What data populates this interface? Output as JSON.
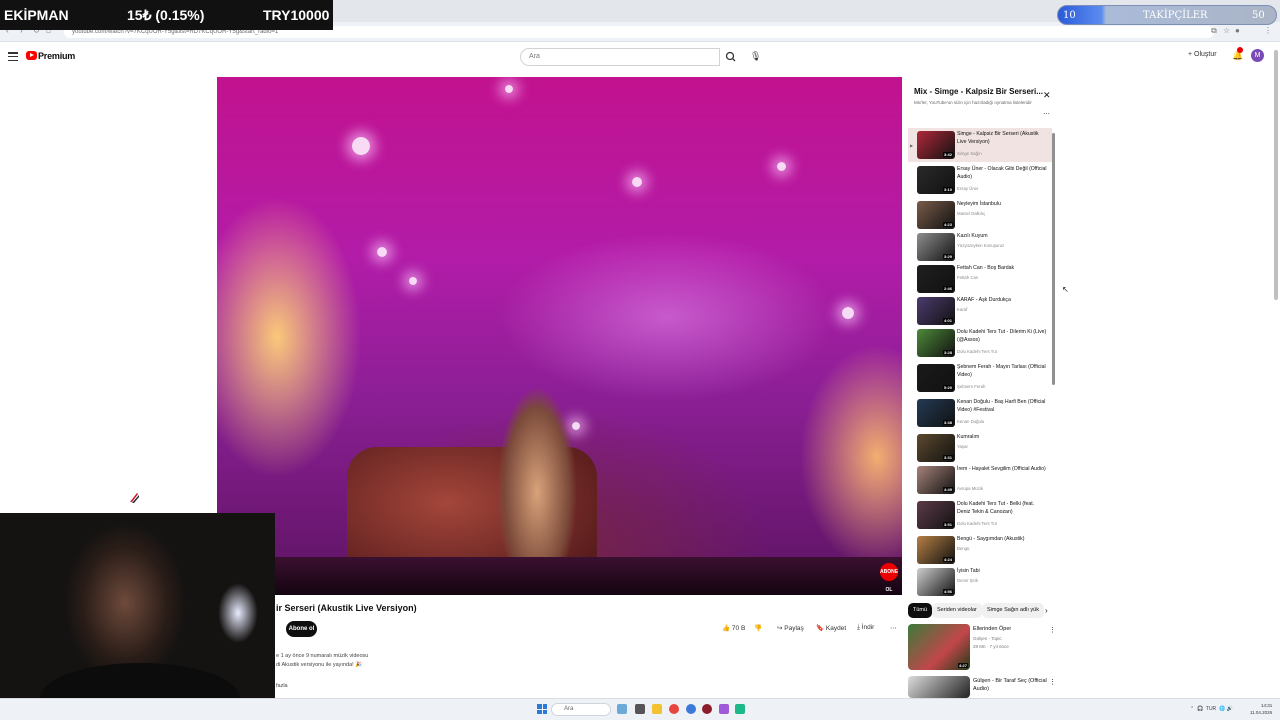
{
  "overlay": {
    "ticker_left": "EKİPMAN",
    "ticker_mid": "15₺ (0.15%)",
    "ticker_right": "TRY10000",
    "follower_count": "10",
    "follower_label": "TAKİPÇİLER",
    "follower_goal": "50",
    "follower_progress": 0.2
  },
  "browser": {
    "url": "youtube.com/watch?v=7KCqUOR-Y5g&list=RD7KCqUOR-Y5g&start_radio=1"
  },
  "header": {
    "logo_text": "Premium",
    "search_placeholder": "Ara",
    "create_label": "+ Oluştur",
    "avatar_letter": "M"
  },
  "video": {
    "title": "ir Serseri (Akustik Live Versiyon)",
    "badge": "ABONE OL",
    "subscribe_label": "Abone ol",
    "like_count": "70 B",
    "share_label": "Paylaş",
    "save_label": "Kaydet",
    "download_label": "İndir",
    "desc_line1": "e 1 ay önce  9 numaralı müzik videosu",
    "desc_line2": "di Akustik versiyonu ile yayında! 🎉",
    "desc_more": "fazla"
  },
  "playlist": {
    "title": "Mix - Simge - Kalpsiz Bir Serseri...",
    "subtitle": "Mix'ler, YouTube'un sizin için hazırladığı oynatma listeleridir",
    "items": [
      {
        "title": "Simge - Kalpsiz Bir Serseri (Akustik Live Versiyon)",
        "artist": "Simge Sağın",
        "duration": "3:42",
        "active": true
      },
      {
        "title": "Ersay Üner - Olacak Gibi Değil (Official Audio)",
        "artist": "Ersay Üner",
        "duration": "3:10"
      },
      {
        "title": "Neyleyim İstanbulu",
        "artist": "Marsel Dalkılıç",
        "duration": "4:23"
      },
      {
        "title": "Kazılı Kuyum",
        "artist": "Yüzyüzeyken Konuşuruz",
        "duration": "3:29"
      },
      {
        "title": "Fettah Can - Boş Bardak",
        "artist": "Fettah Can",
        "duration": "2:46"
      },
      {
        "title": "KARAF - Aşk Durdukça",
        "artist": "Karaf",
        "duration": "4:01"
      },
      {
        "title": "Dolu Kadehi Ters Tut - Dilerim Ki (Live) (@Assos)",
        "artist": "Dolu Kadehi Ters Tut",
        "duration": "3:28"
      },
      {
        "title": "Şebnem Ferah - Mayın Tarlası (Official Video)",
        "artist": "Şebnem Ferah",
        "duration": "5:20"
      },
      {
        "title": "Kenan Doğulu - Baş Harfi Ben (Official Video) #Festival",
        "artist": "Kenan Doğulu",
        "duration": "3:38"
      },
      {
        "title": "Kumralım",
        "artist": "Yaşar",
        "duration": "3:31"
      },
      {
        "title": "İrem - Hayalet Sevgilim (Official Audio)",
        "artist": "Avrupa Müzik",
        "duration": "4:49"
      },
      {
        "title": "Dolu Kadehi Ters Tut - Belki (feat. Deniz Tekin & Canozan)",
        "artist": "Dolu Kadehi Ters Tut",
        "duration": "3:51"
      },
      {
        "title": "Bengü - Saygımdan (Akustik)",
        "artist": "Bengü",
        "duration": "4:24"
      },
      {
        "title": "İyisin Tabi",
        "artist": "Demir Şirik",
        "duration": "4:56"
      }
    ]
  },
  "chips": [
    "Tümü",
    "Seriden videolar",
    "Simge Sağın adlı yük"
  ],
  "related": [
    {
      "title": "Ellerinden Öper",
      "channel": "Gülşen - Topic",
      "meta": "28 Mn · 7 yıl önce",
      "duration": "4:27"
    },
    {
      "title": "Gülşen - Bir Taraf Seç (Official Audio)",
      "channel": "",
      "meta": "",
      "duration": ""
    }
  ],
  "taskbar": {
    "search_placeholder": "Ara",
    "lang": "TUR",
    "time": "14:31",
    "date": "11.04.2026"
  },
  "colors": {
    "yt_red": "#ff0000",
    "active_row": "#f1e3e1",
    "follower_bar": "#2a5bd8"
  }
}
